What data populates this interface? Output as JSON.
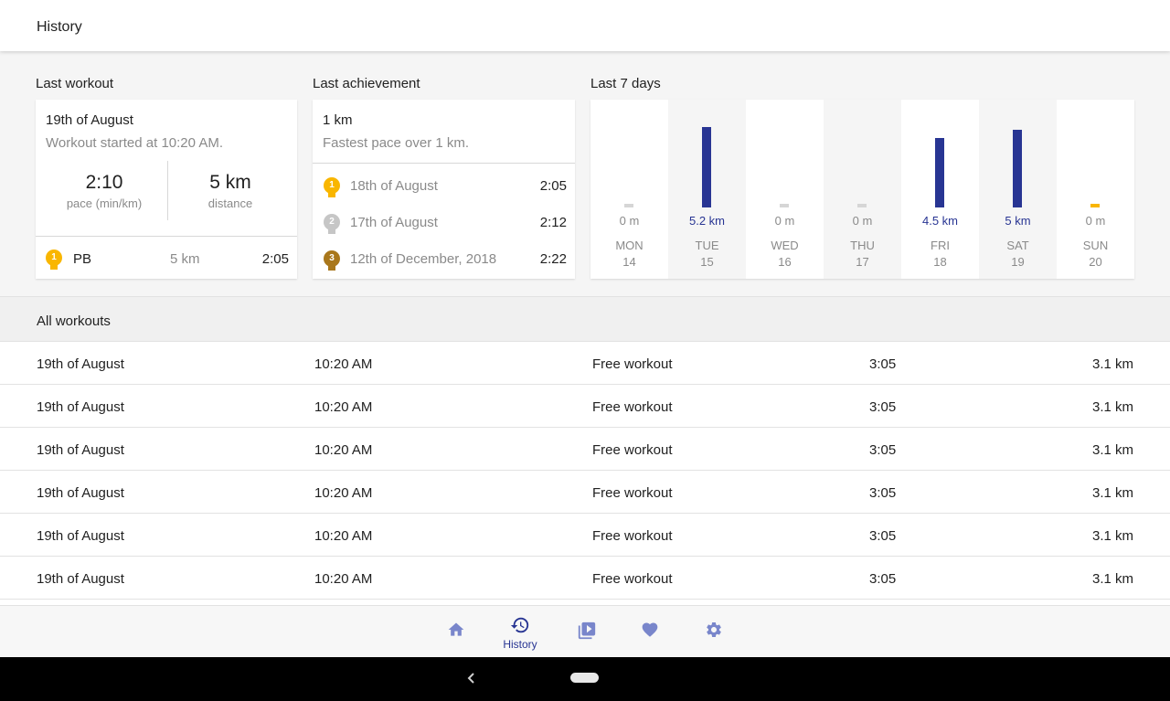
{
  "app": {
    "title": "History"
  },
  "last_workout": {
    "heading": "Last workout",
    "date": "19th of August",
    "subtitle": "Workout started at 10:20 AM.",
    "pace_value": "2:10",
    "pace_label": "pace (min/km)",
    "distance_value": "5 km",
    "distance_label": "distance",
    "pb": {
      "rank": "1",
      "label": "PB",
      "distance": "5 km",
      "time": "2:05"
    }
  },
  "last_achievement": {
    "heading": "Last achievement",
    "title": "1 km",
    "subtitle": "Fastest pace over 1 km.",
    "entries": [
      {
        "rank": "1",
        "date": "18th of August",
        "time": "2:05"
      },
      {
        "rank": "2",
        "date": "17th of August",
        "time": "2:12"
      },
      {
        "rank": "3",
        "date": "12th of December, 2018",
        "time": "2:22"
      }
    ]
  },
  "last_7_days": {
    "heading": "Last 7 days",
    "days": [
      {
        "name": "MON",
        "num": "14",
        "label": "0 m"
      },
      {
        "name": "TUE",
        "num": "15",
        "label": "5.2 km"
      },
      {
        "name": "WED",
        "num": "16",
        "label": "0 m"
      },
      {
        "name": "THU",
        "num": "17",
        "label": "0 m"
      },
      {
        "name": "FRI",
        "num": "18",
        "label": "4.5 km"
      },
      {
        "name": "SAT",
        "num": "19",
        "label": "5 km"
      },
      {
        "name": "SUN",
        "num": "20",
        "label": "0 m"
      }
    ]
  },
  "chart_data": {
    "type": "bar",
    "categories": [
      "MON 14",
      "TUE 15",
      "WED 16",
      "THU 17",
      "FRI 18",
      "SAT 19",
      "SUN 20"
    ],
    "values": [
      0,
      5.2,
      0,
      0,
      4.5,
      5,
      0
    ],
    "xlabel": "",
    "ylabel": "",
    "ylim": [
      0,
      5.2
    ]
  },
  "all_workouts": {
    "heading": "All workouts",
    "rows": [
      {
        "date": "19th of August",
        "time": "10:20 AM",
        "type": "Free workout",
        "pace": "3:05",
        "distance": "3.1 km"
      },
      {
        "date": "19th of August",
        "time": "10:20 AM",
        "type": "Free workout",
        "pace": "3:05",
        "distance": "3.1 km"
      },
      {
        "date": "19th of August",
        "time": "10:20 AM",
        "type": "Free workout",
        "pace": "3:05",
        "distance": "3.1 km"
      },
      {
        "date": "19th of August",
        "time": "10:20 AM",
        "type": "Free workout",
        "pace": "3:05",
        "distance": "3.1 km"
      },
      {
        "date": "19th of August",
        "time": "10:20 AM",
        "type": "Free workout",
        "pace": "3:05",
        "distance": "3.1 km"
      },
      {
        "date": "19th of August",
        "time": "10:20 AM",
        "type": "Free workout",
        "pace": "3:05",
        "distance": "3.1 km"
      }
    ]
  },
  "bottom_nav": {
    "items": [
      {
        "icon": "home-icon",
        "label": ""
      },
      {
        "icon": "history-icon",
        "label": "History",
        "active": true
      },
      {
        "icon": "video-library-icon",
        "label": ""
      },
      {
        "icon": "heart-icon",
        "label": ""
      },
      {
        "icon": "gear-icon",
        "label": ""
      }
    ]
  },
  "colors": {
    "accent": "#283593",
    "gold": "#f9b600",
    "silver": "#c6c6c6",
    "bronze": "#a9771b",
    "muted_icon": "#7986cb",
    "inactive_bar": "#d6d6d6"
  }
}
